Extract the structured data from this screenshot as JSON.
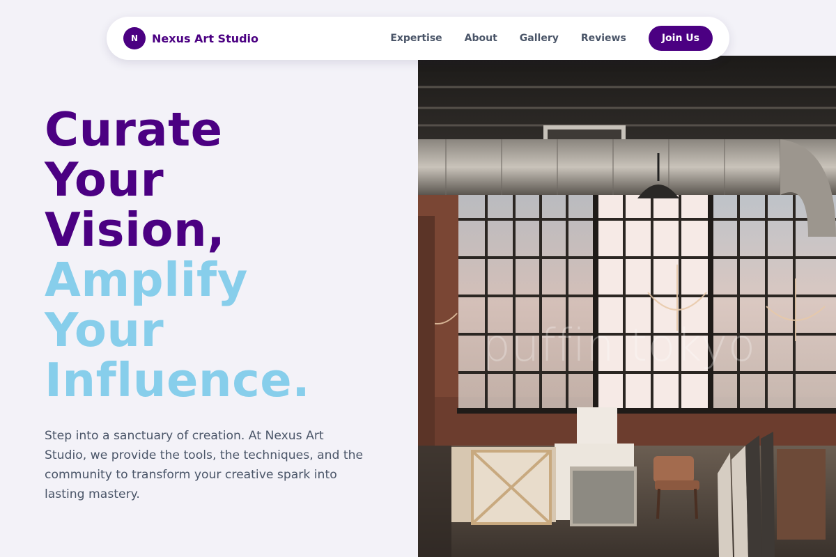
{
  "navbar": {
    "logo_letter": "N",
    "brand_name": "Nexus Art Studio",
    "links": [
      "Expertise",
      "About",
      "Gallery",
      "Reviews"
    ],
    "cta_label": "Join Us"
  },
  "hero": {
    "headline_dark": [
      "Curate",
      "Your",
      "Vision,"
    ],
    "headline_light": [
      "Amplify",
      "Your",
      "Influence."
    ],
    "description": "Step into a sanctuary of creation. At Nexus Art Studio, we provide the tools, the techniques, and the community to transform your creative spark into lasting mastery.",
    "image_watermark": "puffin tokyo"
  },
  "colors": {
    "brand": "#4b0082",
    "accent": "#87ceeb",
    "body_text": "#4a5568",
    "page_bg": "#f3f2f8"
  }
}
